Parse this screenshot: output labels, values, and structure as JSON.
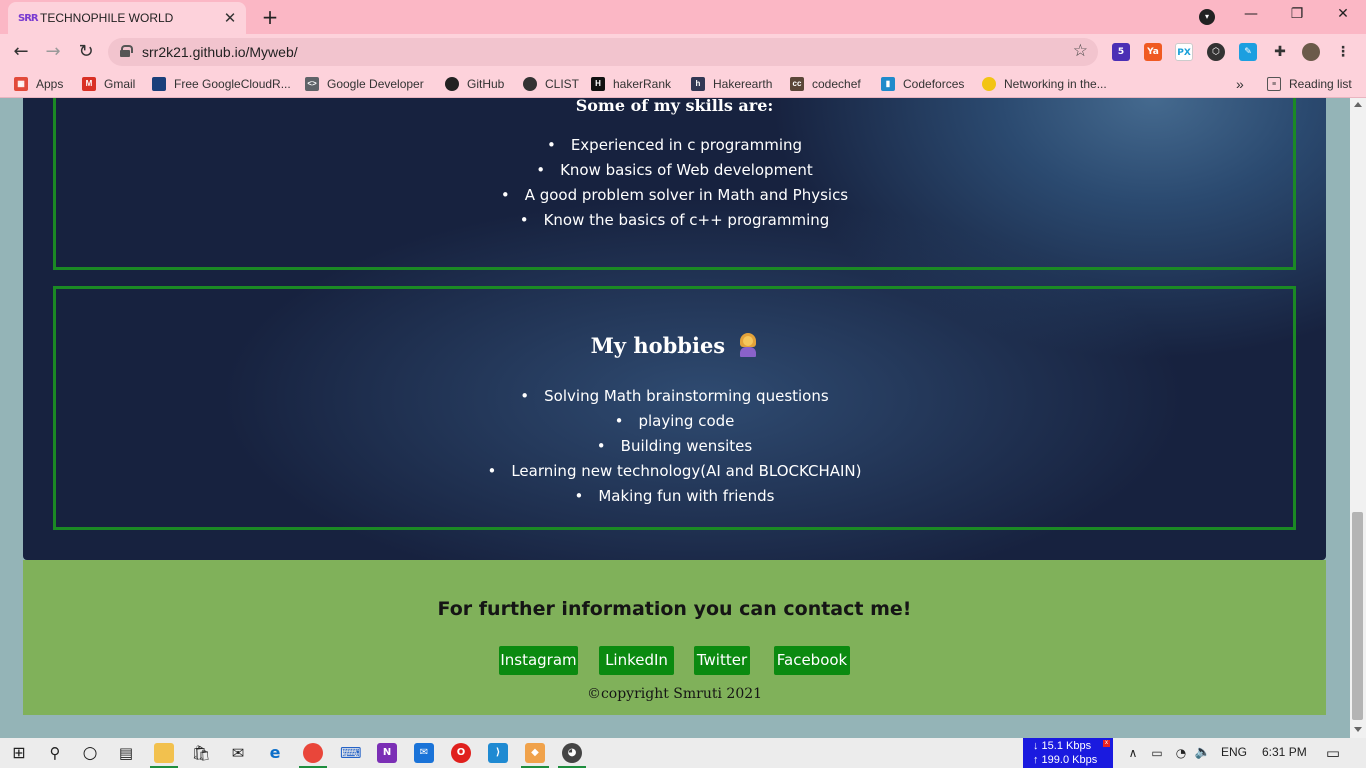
{
  "browser": {
    "tab_title": "TECHNOPHILE WORLD",
    "tab_favicon": "SRR",
    "url": "srr2k21.github.io/Myweb/",
    "profile_badge": "5",
    "bookmarks": [
      {
        "label": "Apps",
        "icon": "apps-grid-icon",
        "color": "#e24a3a"
      },
      {
        "label": "Gmail",
        "icon": "gmail-icon",
        "color": "#d93025"
      },
      {
        "label": "Free GoogleCloudR...",
        "icon": "cloud-icon",
        "color": "#1a3f7a"
      },
      {
        "label": "Google Developer",
        "icon": "code-icon",
        "color": "#5f6368"
      },
      {
        "label": "GitHub",
        "icon": "github-icon",
        "color": "#222222"
      },
      {
        "label": "CLIST",
        "icon": "globe-icon",
        "color": "#333333"
      },
      {
        "label": "hakerRank",
        "icon": "hackerrank-icon",
        "color": "#111111"
      },
      {
        "label": "Hakerearth",
        "icon": "hackerearth-icon",
        "color": "#323754"
      },
      {
        "label": "codechef",
        "icon": "codechef-icon",
        "color": "#5b4638"
      },
      {
        "label": "Codeforces",
        "icon": "bar-chart-icon",
        "color": "#1f8acb"
      },
      {
        "label": "Networking in the...",
        "icon": "bookmark-icon",
        "color": "#f2c414"
      }
    ],
    "reading_list": "Reading list",
    "overflow": "»"
  },
  "page": {
    "skills": {
      "title": "Some of my skills are:",
      "items": [
        "Experienced in c programming",
        "Know basics of Web development",
        "A good problem solver in Math and Physics",
        "Know the basics of c++ programming"
      ]
    },
    "hobbies": {
      "title": "My hobbies",
      "items": [
        "Solving Math brainstorming questions",
        "playing code",
        "Building wensites",
        "Learning new technology(AI and BLOCKCHAIN)",
        "Making fun with friends"
      ]
    },
    "footer": {
      "title": "For further information you can contact me!",
      "links": [
        "Instagram",
        "LinkedIn",
        "Twitter",
        "Facebook"
      ],
      "copyright": "©copyright Smruti 2021"
    }
  },
  "taskbar": {
    "net_down": "↓ 15.1 Kbps",
    "net_up": "↑ 199.0 Kbps",
    "language": "ENG",
    "time": "6:31 PM"
  },
  "colors": {
    "chrome_tabbar": "#fbb7c5",
    "card_border": "#1b8a24",
    "footer_bg": "#80b15a",
    "social_button": "#0b8a10",
    "page_bg": "#94b4b7"
  }
}
